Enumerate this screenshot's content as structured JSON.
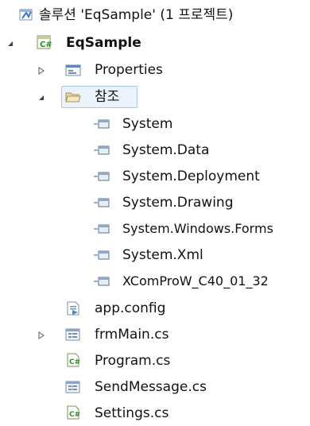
{
  "solution_explorer": {
    "solution_label": "솔루션 'EqSample' (1 프로젝트)",
    "project": {
      "name": "EqSample",
      "children": {
        "properties": "Properties",
        "references": {
          "label": "참조",
          "items": [
            "System",
            "System.Data",
            "System.Deployment",
            "System.Drawing",
            "System.Windows.Forms",
            "System.Xml",
            "XComProW_C40_01_32"
          ]
        },
        "files": [
          {
            "name": "app.config",
            "icon": "config-file-icon"
          },
          {
            "name": "frmMain.cs",
            "icon": "form-file-icon"
          },
          {
            "name": "Program.cs",
            "icon": "csharp-file-icon"
          },
          {
            "name": "SendMessage.cs",
            "icon": "form-file-icon"
          },
          {
            "name": "Settings.cs",
            "icon": "csharp-file-icon"
          }
        ]
      }
    }
  }
}
